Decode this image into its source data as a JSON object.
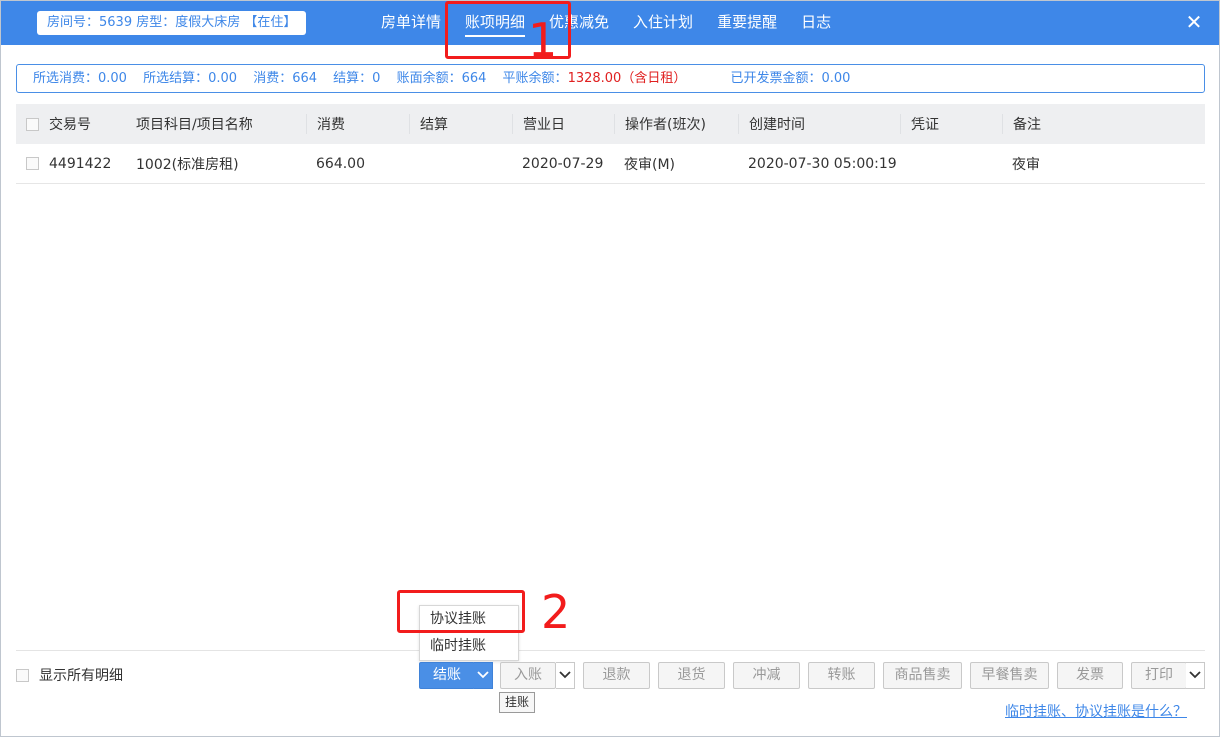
{
  "header": {
    "room_badge": "房间号：5639 房型：度假大床房 【在住】",
    "tabs": [
      {
        "label": "房单详情"
      },
      {
        "label": "账项明细"
      },
      {
        "label": "优惠减免"
      },
      {
        "label": "入住计划"
      },
      {
        "label": "重要提醒"
      },
      {
        "label": "日志"
      }
    ],
    "close_glyph": "✕"
  },
  "summary": {
    "selected_consume": "所选消费：0.00",
    "selected_settle": "所选结算：0.00",
    "consume": "消费：664",
    "settle": "结算：0",
    "book_balance": "账面余额：664",
    "balance_label": "平账余额：",
    "balance_value": "1328.00（含日租）",
    "invoiced": "已开发票金额：0.00"
  },
  "table": {
    "columns": [
      "交易号",
      "项目科目/项目名称",
      "消费",
      "结算",
      "营业日",
      "操作者(班次)",
      "创建时间",
      "凭证",
      "备注"
    ],
    "rows": [
      {
        "txn": "4491422",
        "item": "1002(标准房租)",
        "consume": "664.00",
        "settle": "",
        "biz_day": "2020-07-29",
        "operator": "夜审(M)",
        "created": "2020-07-30 05:00:19",
        "voucher": "",
        "note": "夜审"
      }
    ]
  },
  "footer": {
    "show_all_label": "显示所有明细",
    "dropdown_items": [
      "协议挂账",
      "临时挂账"
    ],
    "buttons": {
      "settle": "结账",
      "post": "入账",
      "refund": "退款",
      "return": "退货",
      "offset": "冲减",
      "transfer": "转账",
      "goods": "商品售卖",
      "breakfast": "早餐售卖",
      "invoice": "发票",
      "print": "打印"
    },
    "tooltip": "挂账",
    "help_link": "临时挂账、协议挂账是什么？"
  },
  "annotations": {
    "label_1": "1",
    "label_2": "2",
    "color": "#f21c1c"
  },
  "colors": {
    "primary": "#3e87e8",
    "alert": "#e02020"
  }
}
